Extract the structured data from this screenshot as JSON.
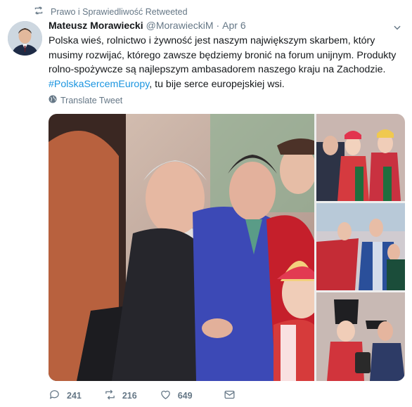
{
  "retweet": {
    "text": "Prawo i Sprawiedliwość Retweeted",
    "icon": "retweet-icon"
  },
  "tweet": {
    "author_name": "Mateusz Morawiecki",
    "handle": "@MorawieckiM",
    "separator": "·",
    "date": "Apr 6",
    "text_part1": "Polska wieś, rolnictwo i żywność jest naszym największym skarbem, który musimy rozwijać, którego zawsze będziemy bronić na forum unijnym. Produkty rolno-spożywcze są najlepszym ambasadorem naszego kraju na Zachodzie. ",
    "hashtag": "#PolskaSercemEuropy",
    "text_part2": ", tu bije serce europejskiej wsi.",
    "translate_label": "Translate Tweet"
  },
  "actions": {
    "replies": "241",
    "retweets": "216",
    "likes": "649"
  },
  "colors": {
    "link": "#1b95e0",
    "secondary": "#657786",
    "text": "#14171a"
  }
}
